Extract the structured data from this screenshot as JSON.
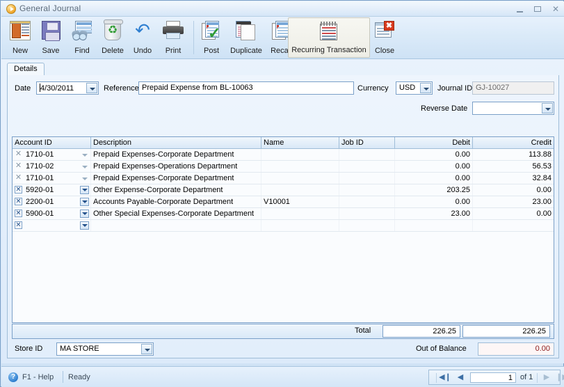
{
  "window": {
    "title": "General Journal",
    "icon": "play-circle-icon",
    "minimize": "–",
    "maximize": "□",
    "close": "✕"
  },
  "toolbar": {
    "buttons": [
      {
        "label": "New",
        "icon": "new-document-icon"
      },
      {
        "label": "Save",
        "icon": "floppy-disk-icon"
      },
      {
        "label": "Find",
        "icon": "binoculars-icon"
      },
      {
        "label": "Delete",
        "icon": "recycle-bin-icon"
      },
      {
        "label": "Undo",
        "icon": "undo-arrow-icon"
      },
      {
        "label": "Print",
        "icon": "printer-icon"
      },
      {
        "label": "Post",
        "icon": "post-checkmark-icon"
      },
      {
        "label": "Duplicate",
        "icon": "duplicate-pages-icon"
      },
      {
        "label": "Recap",
        "icon": "recap-pages-icon"
      },
      {
        "label": "Recurring Transaction",
        "icon": "notepad-icon",
        "selected": true
      },
      {
        "label": "Close",
        "icon": "close-window-icon"
      }
    ]
  },
  "tabs": [
    {
      "label": "Details",
      "active": true
    }
  ],
  "form": {
    "date_label": "Date",
    "date_value": "4/30/2011",
    "reference_label": "Reference",
    "reference_value": "Prepaid Expense from BL-10063",
    "currency_label": "Currency",
    "currency_value": "USD",
    "journal_id_label": "Journal ID",
    "journal_id_value": "GJ-10027",
    "reverse_date_label": "Reverse Date",
    "reverse_date_value": ""
  },
  "grid": {
    "columns": [
      "Account ID",
      "Description",
      "Name",
      "Job ID",
      "Debit",
      "Credit"
    ],
    "rows": [
      {
        "delete_state": "gray",
        "dropdown_state": "flat",
        "account_id": "1710-01",
        "description": "Prepaid Expenses-Corporate Department",
        "name": "",
        "job_id": "",
        "debit": "0.00",
        "credit": "113.88"
      },
      {
        "delete_state": "gray",
        "dropdown_state": "flat",
        "account_id": "1710-02",
        "description": "Prepaid Expenses-Operations Department",
        "name": "",
        "job_id": "",
        "debit": "0.00",
        "credit": "56.53"
      },
      {
        "delete_state": "gray",
        "dropdown_state": "flat",
        "account_id": "1710-01",
        "description": "Prepaid Expenses-Corporate Department",
        "name": "",
        "job_id": "",
        "debit": "0.00",
        "credit": "32.84"
      },
      {
        "delete_state": "box",
        "dropdown_state": "boxed",
        "account_id": "5920-01",
        "description": "Other Expense-Corporate Department",
        "name": "",
        "job_id": "",
        "debit": "203.25",
        "credit": "0.00"
      },
      {
        "delete_state": "box",
        "dropdown_state": "boxed",
        "account_id": "2200-01",
        "description": "Accounts Payable-Corporate Department",
        "name": "V10001",
        "job_id": "",
        "debit": "0.00",
        "credit": "23.00"
      },
      {
        "delete_state": "box",
        "dropdown_state": "boxed",
        "account_id": "5900-01",
        "description": "Other Special Expenses-Corporate Department",
        "name": "",
        "job_id": "",
        "debit": "23.00",
        "credit": "0.00"
      },
      {
        "delete_state": "box",
        "dropdown_state": "boxed",
        "account_id": "",
        "description": "",
        "name": "",
        "job_id": "",
        "debit": "",
        "credit": ""
      }
    ],
    "total_label": "Total",
    "total_debit": "226.25",
    "total_credit": "226.25"
  },
  "footer": {
    "store_id_label": "Store ID",
    "store_id_value": "MA STORE",
    "out_of_balance_label": "Out of Balance",
    "out_of_balance_value": "0.00",
    "out_of_balance_color": "#8b1a1a"
  },
  "statusbar": {
    "help_icon": "question-circle-icon",
    "help_text": "F1 - Help",
    "ready_text": "Ready",
    "nav": {
      "first": "◀❙",
      "prev": "◀",
      "page": "1",
      "of_label": "of 1",
      "next": "▶",
      "last": "❙▶"
    }
  }
}
